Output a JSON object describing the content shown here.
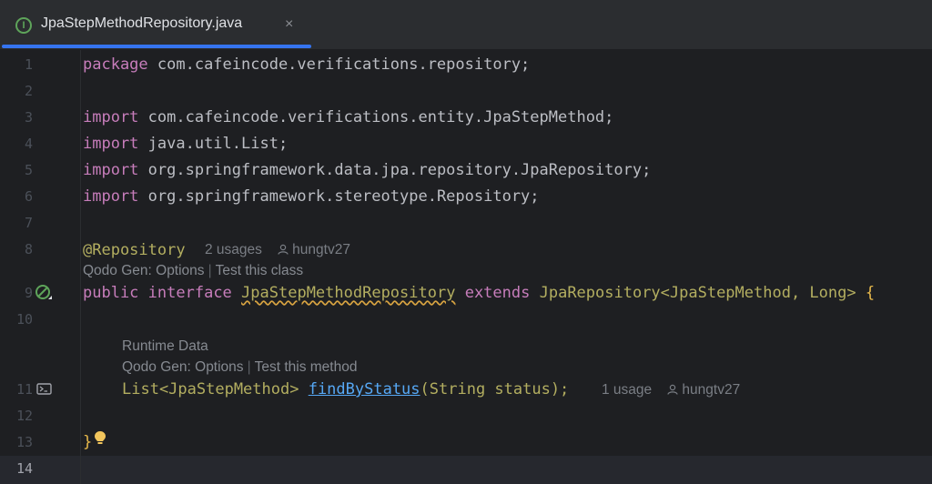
{
  "tab": {
    "icon": "I",
    "title": "JpaStepMethodRepository.java",
    "close": "×"
  },
  "lines": [
    "1",
    "2",
    "3",
    "4",
    "5",
    "6",
    "7",
    "8",
    "9",
    "10",
    "11",
    "12",
    "13",
    "14"
  ],
  "code": {
    "package_kw": "package",
    "package_name": " com.cafeincode.verifications.repository;",
    "import_kw": "import",
    "imports": [
      " com.cafeincode.verifications.entity.JpaStepMethod;",
      " java.util.List;",
      " org.springframework.data.jpa.repository.JpaRepository;",
      " org.springframework.stereotype.Repository;"
    ],
    "annotation": "@Repository",
    "public_kw": "public",
    "interface_kw": "interface",
    "interface_name": "JpaStepMethodRepository",
    "extends_kw": "extends",
    "extends_type": "JpaRepository<JpaStepMethod, Long> ",
    "open_brace": "{",
    "method_return": "List<JpaStepMethod> ",
    "method_name": "findByStatus",
    "method_params": "(String status);",
    "close_brace": "}"
  },
  "hints": {
    "class_usages": "2 usages",
    "class_author": "hungtv27",
    "class_qodo": "Qodo Gen: Options",
    "class_test": "Test this class",
    "runtime_data": "Runtime Data",
    "method_qodo": "Qodo Gen: Options",
    "method_test": "Test this method",
    "method_usages": "1 usage",
    "method_author": "hungtv27"
  },
  "icons": {
    "file": "java-interface-icon",
    "gutter9": "implementations-icon",
    "gutter11": "run-query-icon",
    "bulb": "lightbulb-icon",
    "user": "user-icon"
  }
}
